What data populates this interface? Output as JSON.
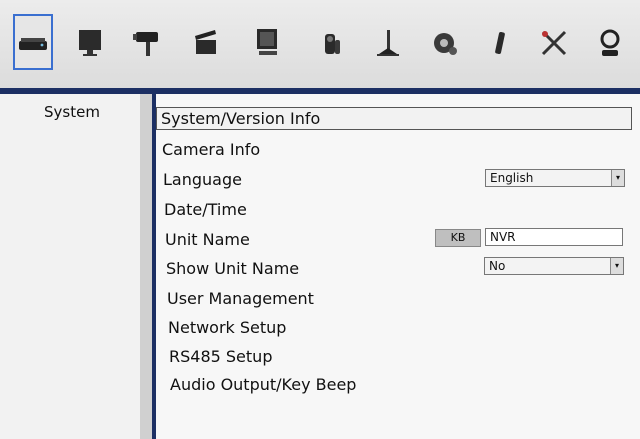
{
  "toolbar": {
    "icons": [
      {
        "name": "dvr-system-icon",
        "selected": true
      },
      {
        "name": "monitor-icon"
      },
      {
        "name": "camera-icon"
      },
      {
        "name": "record-clapper-icon"
      },
      {
        "name": "display-icon"
      },
      {
        "name": "sensor-icon"
      },
      {
        "name": "event-alarm-icon"
      },
      {
        "name": "gear-icon"
      },
      {
        "name": "usb-drive-icon"
      },
      {
        "name": "tools-icon"
      },
      {
        "name": "logout-icon"
      }
    ]
  },
  "sidebar": {
    "items": [
      {
        "label": "System"
      }
    ]
  },
  "menu": {
    "items": [
      {
        "label": "System/Version Info"
      },
      {
        "label": "Camera Info"
      },
      {
        "label": "Language"
      },
      {
        "label": "Date/Time"
      },
      {
        "label": "Unit Name"
      },
      {
        "label": "Show Unit Name"
      },
      {
        "label": "User Management"
      },
      {
        "label": "Network Setup"
      },
      {
        "label": "RS485 Setup"
      },
      {
        "label": "Audio Output/Key Beep"
      }
    ]
  },
  "settings": {
    "language_value": "English",
    "kb_label": "KB",
    "unit_name_value": "NVR",
    "show_unit_name_value": "No",
    "dropdown_arrow": "▾"
  },
  "colors": {
    "accent": "#1c2f63",
    "selection": "#3a6fd0"
  }
}
